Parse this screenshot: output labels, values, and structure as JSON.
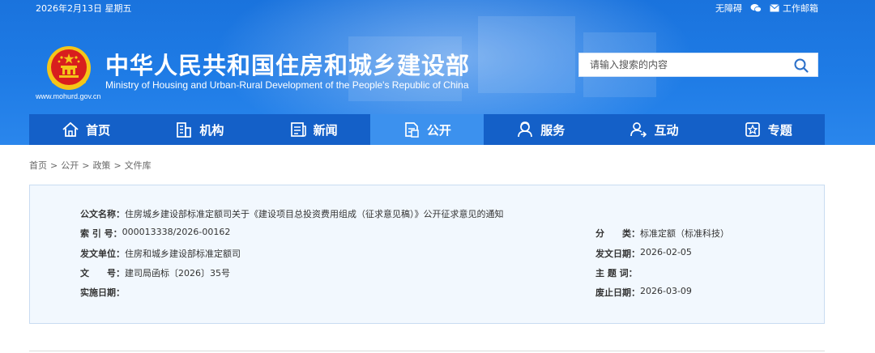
{
  "topbar": {
    "date": "2026年2月13日 星期五",
    "accessibility": "无障碍",
    "work_email": "工作邮箱"
  },
  "header": {
    "title": "中华人民共和国住房和城乡建设部",
    "subtitle": "Ministry of Housing and Urban-Rural Development of the People's Republic of China",
    "url": "www.mohurd.gov.cn"
  },
  "search": {
    "placeholder": "请输入搜索的内容"
  },
  "nav": {
    "items": [
      {
        "label": "首页",
        "icon": "home-icon"
      },
      {
        "label": "机构",
        "icon": "building-icon"
      },
      {
        "label": "新闻",
        "icon": "news-icon"
      },
      {
        "label": "公开",
        "icon": "document-icon"
      },
      {
        "label": "服务",
        "icon": "service-icon"
      },
      {
        "label": "互动",
        "icon": "interaction-icon"
      },
      {
        "label": "专题",
        "icon": "topic-icon"
      }
    ],
    "active_index": 3
  },
  "breadcrumb": {
    "items": [
      "首页",
      "公开",
      "政策",
      "文件库"
    ],
    "separator": ">"
  },
  "document": {
    "title_label": "公文名称：",
    "title_value": "住房城乡建设部标准定额司关于《建设项目总投资费用组成（征求意见稿）》公开征求意见的通知",
    "index_label": "索 引 号：",
    "index_value": "000013338/2026-00162",
    "category_label": "分　　类：",
    "category_value": "标准定额（标准科技）",
    "issuer_label": "发文单位：",
    "issuer_value": "住房和城乡建设部标准定额司",
    "issue_date_label": "发文日期：",
    "issue_date_value": "2026-02-05",
    "doc_no_label": "文　　号：",
    "doc_no_value": "建司局函标〔2026〕35号",
    "keywords_label": "主 题 词：",
    "keywords_value": "",
    "effective_label": "实施日期：",
    "effective_value": "",
    "expiry_label": "废止日期：",
    "expiry_value": "2026-03-09"
  },
  "colors": {
    "header_blue": "#1f7ce6",
    "nav_blue": "#1460c8",
    "nav_active": "#3c91ee",
    "panel_bg": "#f2f8fe",
    "panel_border": "#c9dcf1",
    "emblem_red": "#d81e1e",
    "emblem_gold": "#f5c518"
  }
}
